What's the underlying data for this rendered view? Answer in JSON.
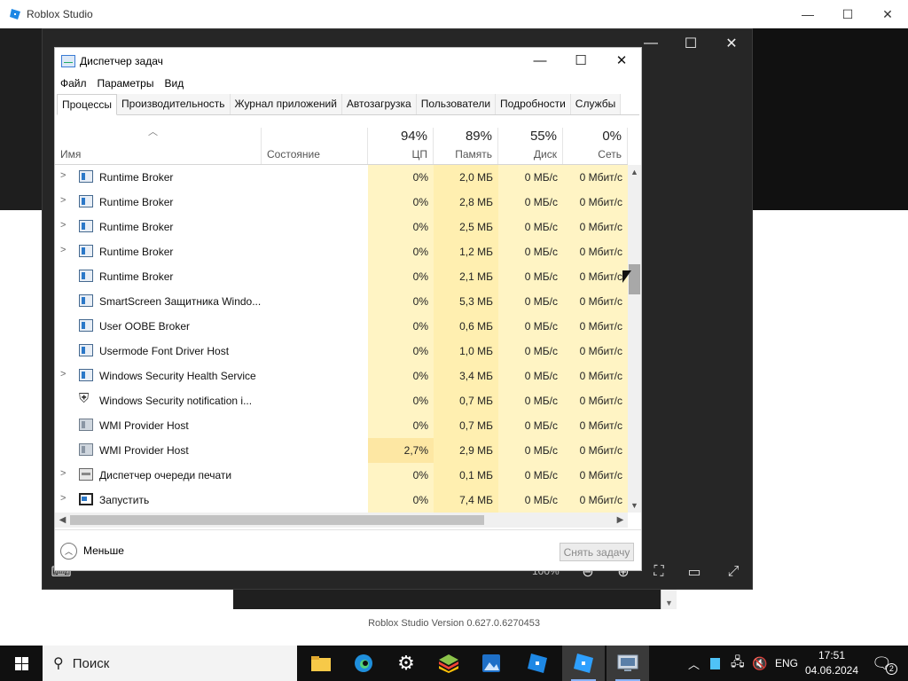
{
  "background_app": {
    "title": "Roblox Studio",
    "version_text": "Roblox Studio Version 0.627.0.6270453"
  },
  "vm": {
    "zoom": "100%"
  },
  "task_manager": {
    "title": "Диспетчер задач",
    "menu": [
      "Файл",
      "Параметры",
      "Вид"
    ],
    "tabs": [
      "Процессы",
      "Производительность",
      "Журнал приложений",
      "Автозагрузка",
      "Пользователи",
      "Подробности",
      "Службы"
    ],
    "active_tab": "Процессы",
    "columns": {
      "name": "Имя",
      "status": "Состояние",
      "cpu": {
        "percent": "94%",
        "label": "ЦП"
      },
      "memory": {
        "percent": "89%",
        "label": "Память"
      },
      "disk": {
        "percent": "55%",
        "label": "Диск"
      },
      "network": {
        "percent": "0%",
        "label": "Сеть"
      }
    },
    "rows": [
      {
        "name": "Runtime Broker",
        "expandable": true,
        "icon": "app-window-icon",
        "cpu": "0%",
        "mem": "2,0 МБ",
        "disk": "0 МБ/с",
        "net": "0 Мбит/с"
      },
      {
        "name": "Runtime Broker",
        "expandable": true,
        "icon": "app-window-icon",
        "cpu": "0%",
        "mem": "2,8 МБ",
        "disk": "0 МБ/с",
        "net": "0 Мбит/с"
      },
      {
        "name": "Runtime Broker",
        "expandable": true,
        "icon": "app-window-icon",
        "cpu": "0%",
        "mem": "2,5 МБ",
        "disk": "0 МБ/с",
        "net": "0 Мбит/с"
      },
      {
        "name": "Runtime Broker",
        "expandable": true,
        "icon": "app-window-icon",
        "cpu": "0%",
        "mem": "1,2 МБ",
        "disk": "0 МБ/с",
        "net": "0 Мбит/с"
      },
      {
        "name": "Runtime Broker",
        "expandable": false,
        "icon": "app-window-icon",
        "cpu": "0%",
        "mem": "2,1 МБ",
        "disk": "0 МБ/с",
        "net": "0 Мбит/с"
      },
      {
        "name": "SmartScreen Защитника Windo...",
        "expandable": false,
        "icon": "app-window-icon",
        "cpu": "0%",
        "mem": "5,3 МБ",
        "disk": "0 МБ/с",
        "net": "0 Мбит/с"
      },
      {
        "name": "User OOBE Broker",
        "expandable": false,
        "icon": "app-window-icon",
        "cpu": "0%",
        "mem": "0,6 МБ",
        "disk": "0 МБ/с",
        "net": "0 Мбит/с"
      },
      {
        "name": "Usermode Font Driver Host",
        "expandable": false,
        "icon": "app-window-icon",
        "cpu": "0%",
        "mem": "1,0 МБ",
        "disk": "0 МБ/с",
        "net": "0 Мбит/с"
      },
      {
        "name": "Windows Security Health Service",
        "expandable": true,
        "icon": "app-window-icon",
        "cpu": "0%",
        "mem": "3,4 МБ",
        "disk": "0 МБ/с",
        "net": "0 Мбит/с"
      },
      {
        "name": "Windows Security notification i...",
        "expandable": false,
        "icon": "shield-icon",
        "cpu": "0%",
        "mem": "0,7 МБ",
        "disk": "0 МБ/с",
        "net": "0 Мбит/с"
      },
      {
        "name": "WMI Provider Host",
        "expandable": false,
        "icon": "wmi-icon",
        "cpu": "0%",
        "mem": "0,7 МБ",
        "disk": "0 МБ/с",
        "net": "0 Мбит/с"
      },
      {
        "name": "WMI Provider Host",
        "expandable": false,
        "icon": "wmi-icon",
        "cpu": "2,7%",
        "mem": "2,9 МБ",
        "disk": "0 МБ/с",
        "net": "0 Мбит/с",
        "hot": true
      },
      {
        "name": "Диспетчер очереди печати",
        "expandable": true,
        "icon": "printer-icon",
        "cpu": "0%",
        "mem": "0,1 МБ",
        "disk": "0 МБ/с",
        "net": "0 Мбит/с"
      },
      {
        "name": "Запустить",
        "expandable": true,
        "icon": "run-icon",
        "cpu": "0%",
        "mem": "7,4 МБ",
        "disk": "0 МБ/с",
        "net": "0 Мбит/с"
      }
    ],
    "footer": {
      "less_label": "Меньше",
      "end_task_label": "Снять задачу"
    }
  },
  "taskbar": {
    "search_placeholder": "Поиск",
    "language": "ENG",
    "time": "17:51",
    "date": "04.06.2024",
    "notification_count": "2",
    "pinned": [
      "file-explorer-icon",
      "edge-icon",
      "settings-icon",
      "bluestacks-icon",
      "photos-icon",
      "roblox-studio-icon",
      "roblox-player-icon",
      "remote-desktop-icon"
    ]
  }
}
